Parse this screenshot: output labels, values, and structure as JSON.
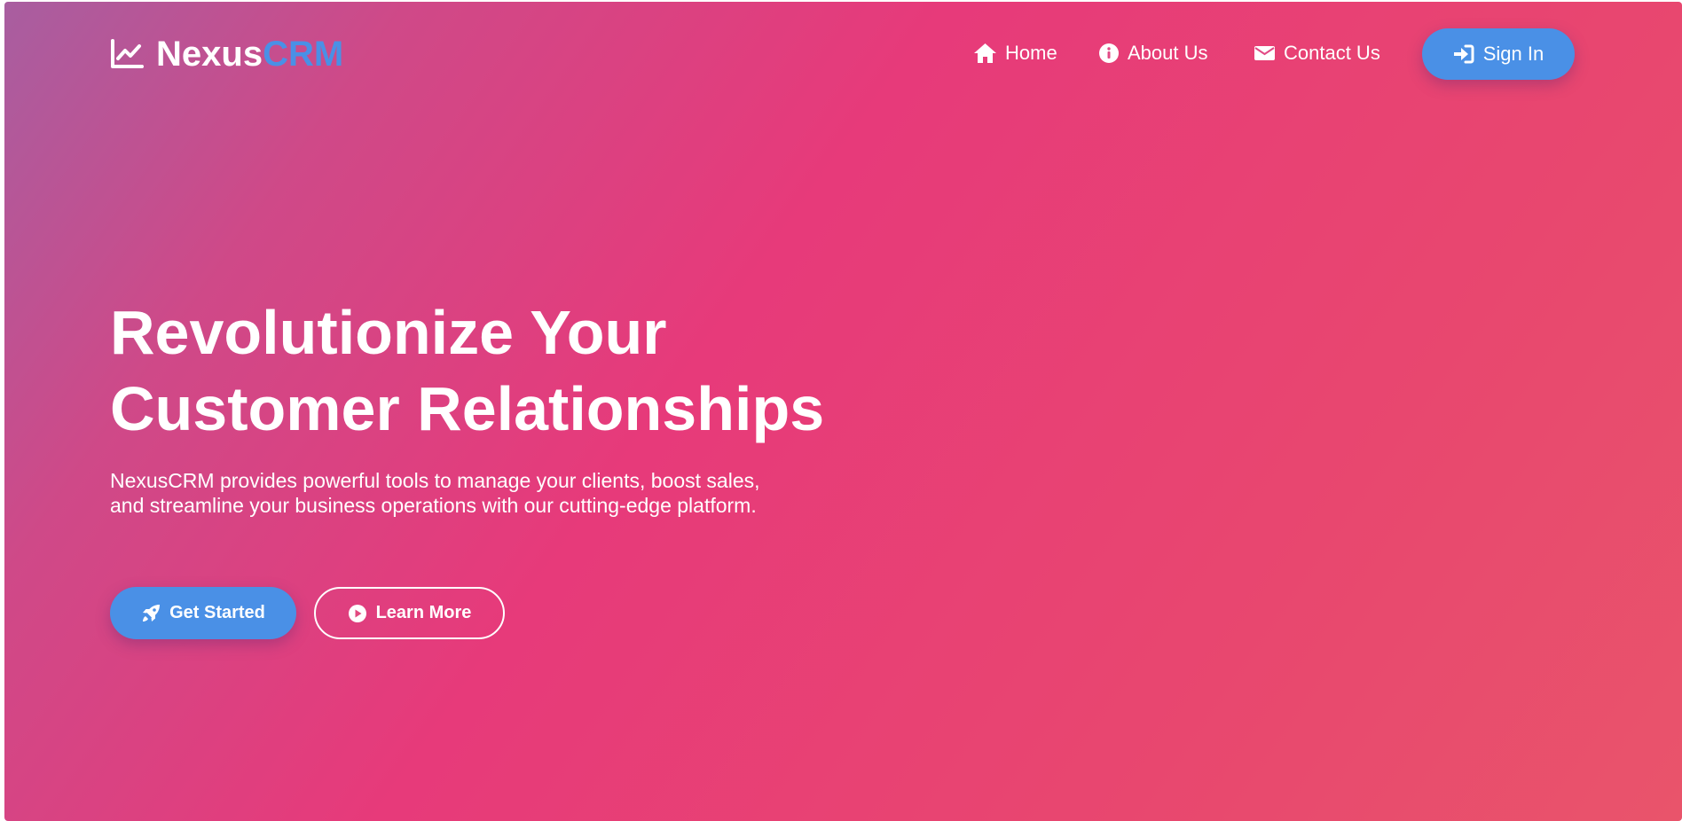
{
  "brand": {
    "name_primary": "Nexus",
    "name_accent": "CRM",
    "logo_icon": "chart-line-icon",
    "accent_color": "#4a90e6"
  },
  "nav": {
    "items": [
      {
        "label": "Home",
        "icon": "home-icon"
      },
      {
        "label": "About Us",
        "icon": "info-circle-icon"
      },
      {
        "label": "Contact Us",
        "icon": "envelope-icon"
      }
    ],
    "signin": {
      "label": "Sign In",
      "icon": "sign-in-icon"
    }
  },
  "hero": {
    "headline_line1": "Revolutionize Your",
    "headline_line2": "Customer Relationships",
    "subtitle": "NexusCRM provides powerful tools to manage your clients, boost sales, and streamline your business operations with our cutting-edge platform.",
    "primary_cta": {
      "label": "Get Started",
      "icon": "rocket-icon"
    },
    "secondary_cta": {
      "label": "Learn More",
      "icon": "play-circle-icon"
    }
  },
  "colors": {
    "gradient_start": "#a85ea0",
    "gradient_mid": "#e73a7a",
    "gradient_end": "#e9546b",
    "button_blue": "#4a90e6"
  }
}
